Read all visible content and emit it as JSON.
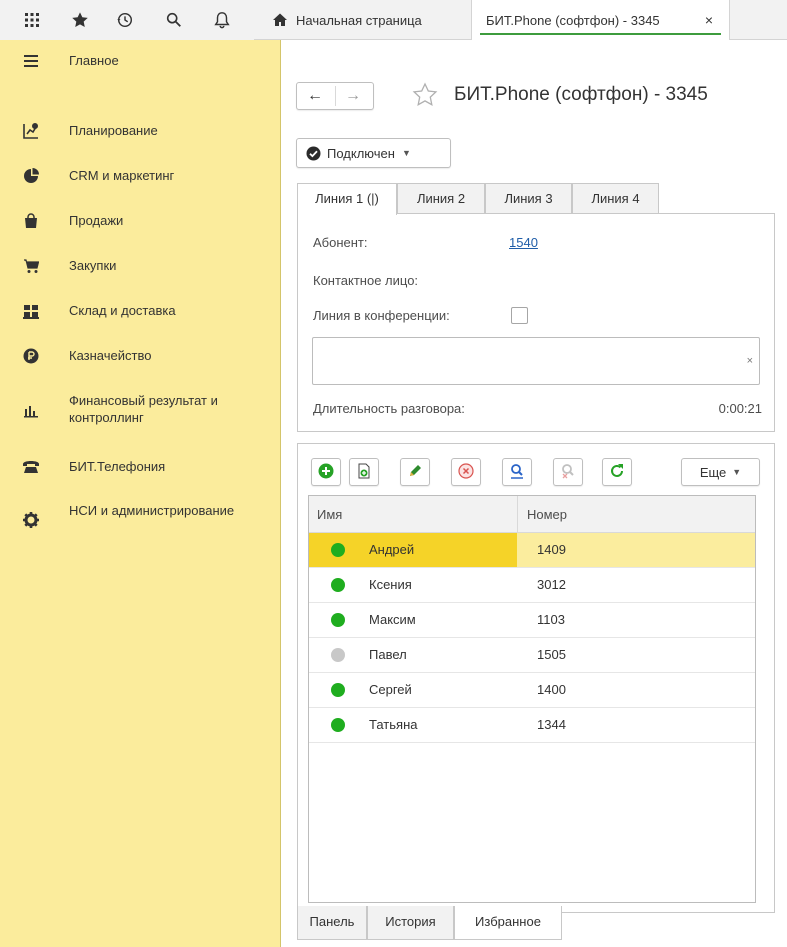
{
  "topbar": {
    "icons": [
      "apps-grid-icon",
      "star-icon",
      "history-icon",
      "search-icon",
      "bell-icon"
    ],
    "home_tab": {
      "label": "Начальная страница",
      "icon": "home-icon"
    },
    "doc_tab": {
      "label": "БИТ.Phone (софтфон) - 3345",
      "close": "×"
    }
  },
  "sidebar": {
    "items": [
      {
        "label": "Главное",
        "icon": "menu-lines-icon"
      },
      {
        "label": "Планирование",
        "icon": "planning-icon"
      },
      {
        "label": "CRM и маркетинг",
        "icon": "pie-chart-icon"
      },
      {
        "label": "Продажи",
        "icon": "shopping-bag-icon"
      },
      {
        "label": "Закупки",
        "icon": "cart-icon"
      },
      {
        "label": "Склад и доставка",
        "icon": "warehouse-icon"
      },
      {
        "label": "Казначейство",
        "icon": "ruble-coin-icon"
      },
      {
        "label": "Финансовый результат и контроллинг",
        "icon": "bar-chart-icon"
      },
      {
        "label": "БИТ.Телефония",
        "icon": "telephone-icon"
      },
      {
        "label": "НСИ и администрирование",
        "icon": "gear-icon"
      }
    ]
  },
  "page": {
    "title": "БИТ.Phone (софтфон) - 3345",
    "back": "←",
    "forward": "→",
    "status_button": "Подключен",
    "line_tabs": [
      "Линия 1 (|)",
      "Линия 2",
      "Линия 3",
      "Линия 4"
    ],
    "subscriber_label": "Абонент:",
    "subscriber_value": "1540",
    "contact_label": "Контактное лицо:",
    "conference_label": "Линия в конференции:",
    "duration_label": "Длительность разговора:",
    "duration_value": "0:00:21",
    "clear": "×"
  },
  "list": {
    "more_button": "Еще",
    "toolbar_icons": [
      "add-icon",
      "copy-icon",
      "edit-icon",
      "delete-icon",
      "find-icon",
      "cancel-search-icon",
      "refresh-icon"
    ],
    "columns": [
      "Имя",
      "Номер"
    ],
    "rows": [
      {
        "name": "Андрей",
        "number": "1409",
        "status_color": "#1fad1f",
        "selected": true
      },
      {
        "name": "Ксения",
        "number": "3012",
        "status_color": "#1fad1f"
      },
      {
        "name": "Максим",
        "number": "1103",
        "status_color": "#1fad1f"
      },
      {
        "name": "Павел",
        "number": "1505",
        "status_color": "#c8c8c8"
      },
      {
        "name": "Сергей",
        "number": "1400",
        "status_color": "#1fad1f"
      },
      {
        "name": "Татьяна",
        "number": "1344",
        "status_color": "#1fad1f"
      }
    ]
  },
  "bottom_tabs": [
    "Панель",
    "История",
    "Избранное"
  ],
  "colors": {
    "sidebar_bg": "#fbec9c",
    "selection": "#f5d328",
    "status_green": "#1fad1f",
    "accent_green": "#3e9c3e"
  }
}
